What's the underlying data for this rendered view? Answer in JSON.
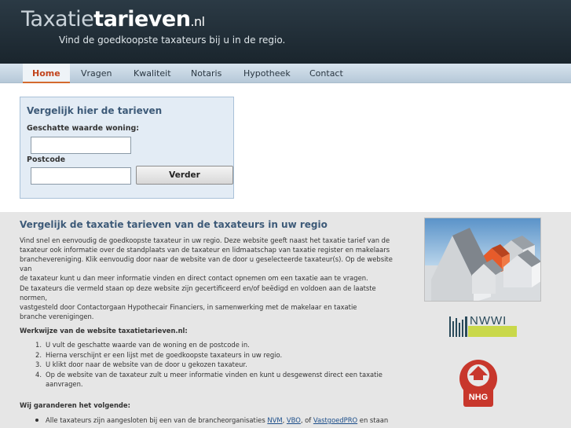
{
  "header": {
    "logo_part1": "Taxatie",
    "logo_part2": "tarieven",
    "logo_part3": ".nl",
    "tagline": "Vind de goedkoopste taxateurs bij u in de regio."
  },
  "nav": {
    "items": [
      "Home",
      "Vragen",
      "Kwaliteit",
      "Notaris",
      "Hypotheek",
      "Contact"
    ],
    "active": "Home"
  },
  "form": {
    "title": "Vergelijk hier de tarieven",
    "value_label": "Geschatte waarde woning:",
    "value_input": "",
    "postcode_label": "Postcode",
    "postcode_input": "",
    "submit_label": "Verder"
  },
  "content": {
    "heading": "Vergelijk de taxatie tarieven van de taxateurs in uw regio",
    "p1_lines": [
      "Vind snel en eenvoudig de goedkoopste taxateur in uw regio. Deze website geeft naast het taxatie tarief van de",
      "taxateur ook informatie over de standplaats van de taxateur en lidmaatschap van taxatie register en makelaars",
      "branchevereniging. Klik eenvoudig door naar de website van de door u geselecteerde taxateur(s). Op de website van",
      "de taxateur kunt u dan meer informatie vinden en direct contact opnemen om een taxatie aan te vragen."
    ],
    "p2_lines": [
      "De taxateurs die vermeld staan op deze website zijn gecertificeerd en/of beëdigd en voldoen aan de laatste normen,",
      "vastgesteld door Contactorgaan Hypothecair Financiers, in samenwerking met de makelaar en taxatie",
      "branche verenigingen."
    ],
    "werkwijze_title": "Werkwijze van de website taxatietarieven.nl:",
    "steps": [
      {
        "num": "1.",
        "lines": [
          "U vult de geschatte waarde van de woning en de postcode in."
        ]
      },
      {
        "num": "2.",
        "lines": [
          "Hierna verschijnt er een lijst met de goedkoopste taxateurs in uw regio."
        ]
      },
      {
        "num": "3.",
        "lines": [
          "U klikt door naar de website van de door u gekozen taxateur."
        ]
      },
      {
        "num": "4.",
        "lines": [
          "Op de website van de taxateur zult u meer informatie vinden en kunt u desgewenst direct een taxatie",
          "aanvragen."
        ]
      }
    ],
    "garantie_title": "Wij garanderen het volgende:",
    "bullet_prefix": "Alle taxateurs zijn aangesloten bij een van de brancheorganisaties ",
    "bullet_link1": "NVM",
    "bullet_sep1": ", ",
    "bullet_link2": "VBO",
    "bullet_sep2": ", of ",
    "bullet_link3": "VastgoedPRO",
    "bullet_suffix": " en staan"
  },
  "logos": {
    "nwwi_text": "NWWI",
    "nhg_text": "NHG"
  },
  "colors": {
    "header_bg": "#1f2b33",
    "nav_bg": "#c6d6e4",
    "active_nav": "#c2441d",
    "form_bg": "#e3ecf5",
    "heading": "#3d5a78",
    "content_bg": "#e6e6e6",
    "link": "#1c4e8a",
    "nwwi_green": "#c9d84a",
    "nhg_red": "#c8372c"
  }
}
